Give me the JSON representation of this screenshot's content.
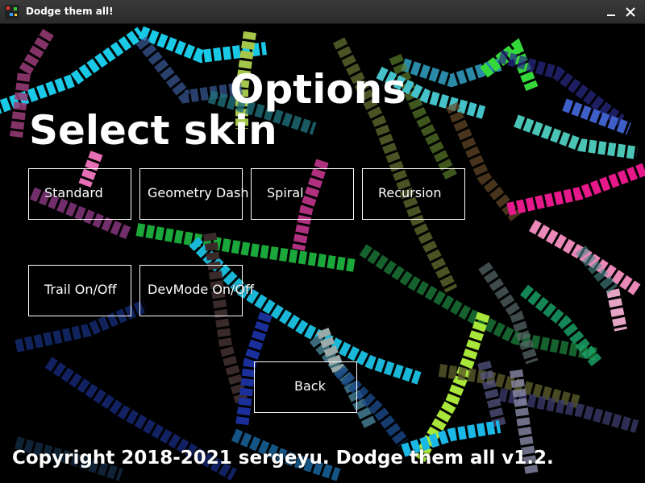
{
  "window": {
    "title": "Dodge them all!",
    "icon": "app-icon",
    "minimize_icon": "minimize-icon",
    "close_icon": "close-icon"
  },
  "options": {
    "title": "Options",
    "skin_heading": "Select skin",
    "skins": [
      {
        "label": "Standard"
      },
      {
        "label": "Geometry Dash"
      },
      {
        "label": "Spiral"
      },
      {
        "label": "Recursion"
      }
    ],
    "toggles": [
      {
        "label": "Trail On/Off"
      },
      {
        "label": "DevMode On/Off"
      }
    ],
    "back_label": "Back"
  },
  "footer": {
    "copyright": "Copyright 2018-2021 sergeyu. Dodge them all v1.2."
  },
  "colors": {
    "background": "#000000",
    "text": "#ffffff",
    "button_border": "#ffffff"
  }
}
